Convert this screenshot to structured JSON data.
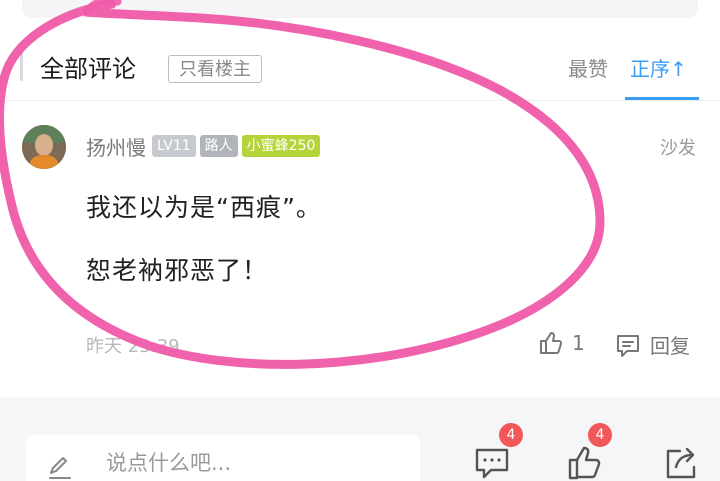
{
  "section": {
    "title": "全部评论",
    "op_only_label": "只看楼主",
    "sort_hot_label": "最赞",
    "sort_order_label": "正序↑"
  },
  "comment": {
    "username": "扬州慢",
    "level_badge": "LV11",
    "role_badge": "路人",
    "bee_badge": "小蜜蜂250",
    "floor_label": "沙发",
    "lines": [
      "我还以为是“西痕”。",
      "恕老衲邪恶了！"
    ],
    "time": "昨天 23:39",
    "like_count": "1",
    "reply_label": "回复"
  },
  "bottom_bar": {
    "input_placeholder": "说点什么吧...",
    "comments_badge": "4",
    "likes_badge": "4"
  },
  "colors": {
    "accent": "#3a9df3",
    "annotation": "#ef5aa8",
    "badge_red": "#f2575a",
    "bee_green": "#b5d33a"
  },
  "icons": [
    "pencil-icon",
    "comment-bubble-icon",
    "thumb-up-icon",
    "share-icon",
    "reply-bubble-icon"
  ]
}
